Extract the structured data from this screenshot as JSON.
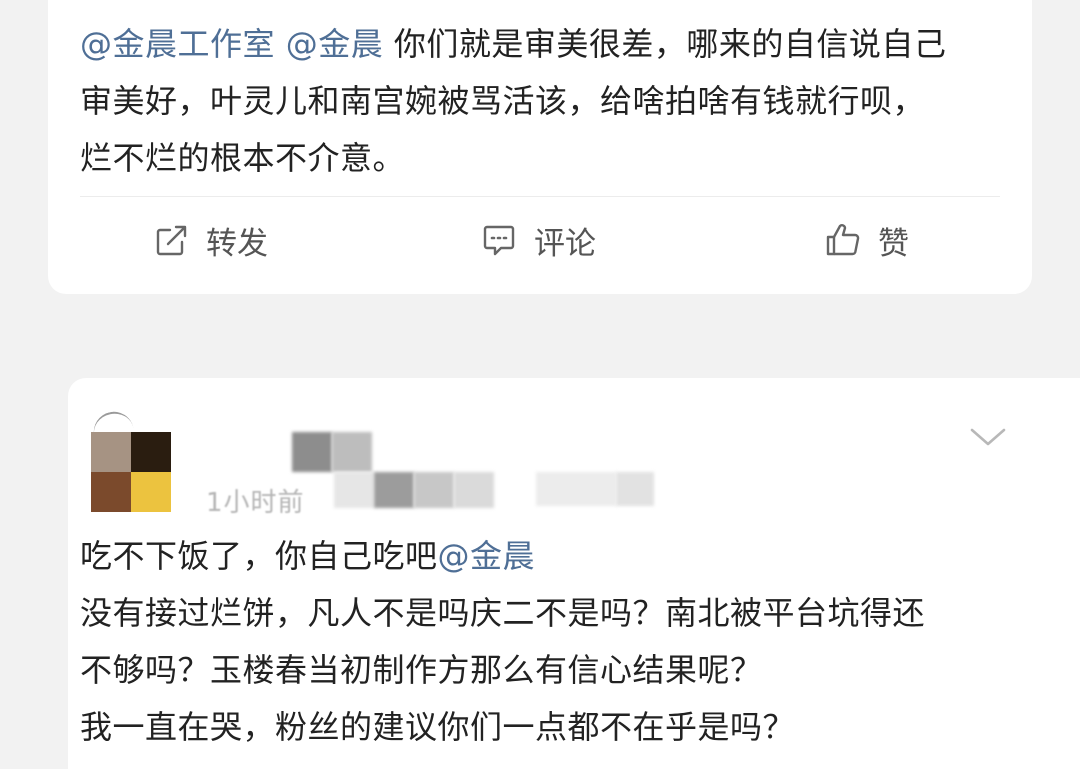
{
  "post": {
    "mention1": "@金晨工作室",
    "mention2": "@金晨",
    "line1_rest": "你们就是审美很差，哪来的自信说自己",
    "line2": "审美好，叶灵儿和南宫婉被骂活该，给啥拍啥有钱就行呗，",
    "line3": "烂不烂的根本不介意。"
  },
  "actions": {
    "repost": {
      "label": "转发",
      "icon": "share-icon"
    },
    "comment": {
      "label": "评论",
      "icon": "comment-icon"
    },
    "like": {
      "label": "赞",
      "icon": "thumbs-up-icon"
    }
  },
  "comment": {
    "avatar_colors": [
      "#a69383",
      "#2a1d10",
      "#7b4a2c",
      "#ecc33f"
    ],
    "timestamp_partial": "1小时前",
    "line1_text": "吃不下饭了，你自己吃吧",
    "line1_mention": "@金晨",
    "line2": "没有接过烂饼，凡人不是吗庆二不是吗？南北被平台坑得还",
    "line3": "不够吗？玉楼春当初制作方那么有信心结果呢？",
    "line4": "我一直在哭，粉丝的建议你们一点都不在乎是吗？"
  },
  "colors": {
    "mention": "#4f6f96",
    "text": "#222222",
    "action": "#555555",
    "background": "#f2f2f2"
  }
}
